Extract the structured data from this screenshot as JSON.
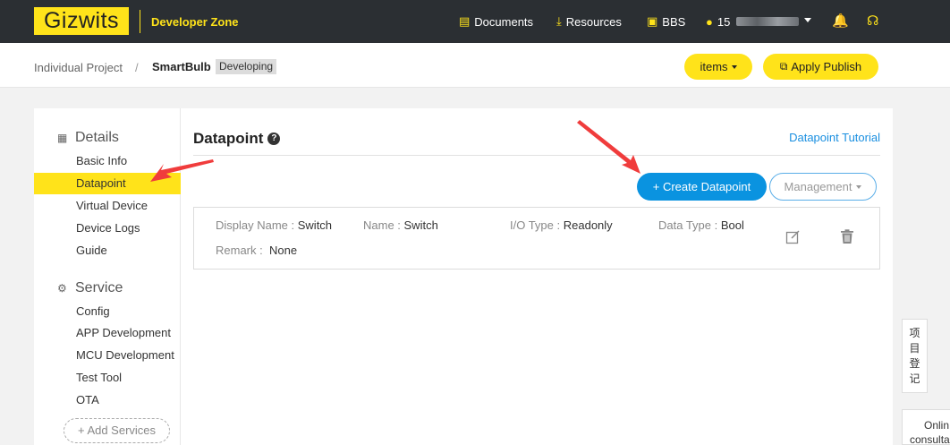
{
  "topnav": {
    "logo": "Gizwits",
    "zone": "Developer Zone",
    "links": [
      {
        "label": "Documents",
        "icon": "document-icon"
      },
      {
        "label": "Resources",
        "icon": "download-icon"
      },
      {
        "label": "BBS",
        "icon": "chat-icon"
      }
    ],
    "user_prefix": "15",
    "colors": {
      "bar": "#2b2f33",
      "accent": "#ffe31a"
    }
  },
  "subheader": {
    "crumb_parent": "Individual Project",
    "crumb_sep": "/",
    "crumb_current": "SmartBulb",
    "status": "Developing",
    "items_btn": "items",
    "publish_btn": "Apply Publish"
  },
  "sidebar": {
    "details_head": "Details",
    "details_items": [
      "Basic Info",
      "Datapoint",
      "Virtual Device",
      "Device Logs",
      "Guide"
    ],
    "service_head": "Service",
    "service_items": [
      "Config",
      "APP Development",
      "MCU Development",
      "Test Tool",
      "OTA"
    ],
    "add_services": "+ Add Services",
    "active": "Datapoint"
  },
  "main": {
    "title": "Datapoint",
    "tutorial": "Datapoint Tutorial",
    "create_btn": "+ Create Datapoint",
    "management_btn": "Management",
    "datapoint": {
      "display_name_label": "Display Name : ",
      "display_name": "Switch",
      "name_label": "Name : ",
      "name": "Switch",
      "io_label": "I/O Type : ",
      "io": "Readonly",
      "dtype_label": "Data Type : ",
      "dtype": "Bool",
      "remark_label": "Remark :  ",
      "remark": "None"
    },
    "colors": {
      "primary": "#0a93e0",
      "arrow": "#f03c3c"
    }
  },
  "floating": {
    "register_chars": [
      "项",
      "目",
      "登",
      "记"
    ],
    "online_lines": [
      "Onlin",
      "consulta"
    ]
  }
}
